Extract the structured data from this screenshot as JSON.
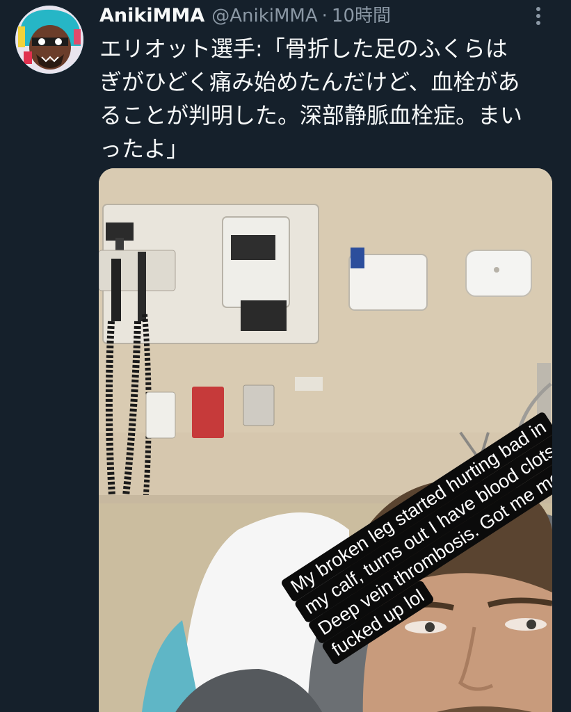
{
  "tweet": {
    "display_name": "AnikiMMA",
    "handle": "@AnikiMMA",
    "separator": "·",
    "time": "10時間",
    "text_lines": [
      "エリオット選手:「骨折した足のふくらは",
      "ぎがひどく痛み始めたんだけど、血栓があ",
      "ることが判明した。深部静脈血栓症。まい",
      "ったよ」"
    ]
  },
  "media": {
    "caption_lines": [
      "My broken leg started hurting bad in",
      "my calf, turns out I have blood clots.",
      "Deep vein thrombosis. Got me me",
      "fucked up lol"
    ]
  },
  "icons": {
    "avatar": "avatar-icon",
    "more": "more-options-icon"
  },
  "colors": {
    "background": "#15202b",
    "primary_text": "#f7f9f9",
    "secondary_text": "#8b98a5"
  }
}
